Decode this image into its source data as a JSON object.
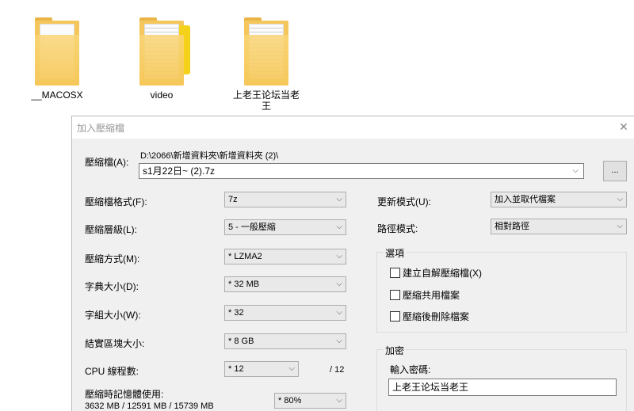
{
  "desktop": {
    "icons": [
      {
        "label": "__MACOSX"
      },
      {
        "label": "video"
      },
      {
        "label": "上老王论坛当老\n王"
      }
    ]
  },
  "dialog": {
    "title": "加入壓縮檔",
    "close_glyph": "✕",
    "archive_label": "壓縮檔(A):",
    "archive_path": "D:\\2066\\新增資料夾\\新增資料夾 (2)\\",
    "archive_name": "s1月22日~ (2).7z",
    "browse_label": "...",
    "left": {
      "format_label": "壓縮檔格式(F):",
      "format_value": "7z",
      "level_label": "壓縮層級(L):",
      "level_value": "5 - 一般壓縮",
      "method_label": "壓縮方式(M):",
      "method_value": "* LZMA2",
      "dict_label": "字典大小(D):",
      "dict_value": "* 32 MB",
      "word_label": "字組大小(W):",
      "word_value": "* 32",
      "solid_label": "結實區塊大小:",
      "solid_value": "* 8 GB",
      "cpu_label": "CPU 線程數:",
      "cpu_value": "* 12",
      "cpu_total": "/ 12",
      "memory_label": "壓縮時記憶體使用:",
      "memory_stats": "3632 MB / 12591 MB / 15739 MB",
      "memory_value": "* 80%"
    },
    "right": {
      "update_label": "更新模式(U):",
      "update_value": "加入並取代檔案",
      "path_label": "路徑模式:",
      "path_value": "相對路徑",
      "options_title": "選項",
      "opt_sfx": "建立自解壓縮檔(X)",
      "opt_shared": "壓縮共用檔案",
      "opt_delete": "壓縮後刪除檔案",
      "encrypt_title": "加密",
      "password_label": "輸入密碼:",
      "password_value": "上老王论坛当老王"
    }
  }
}
